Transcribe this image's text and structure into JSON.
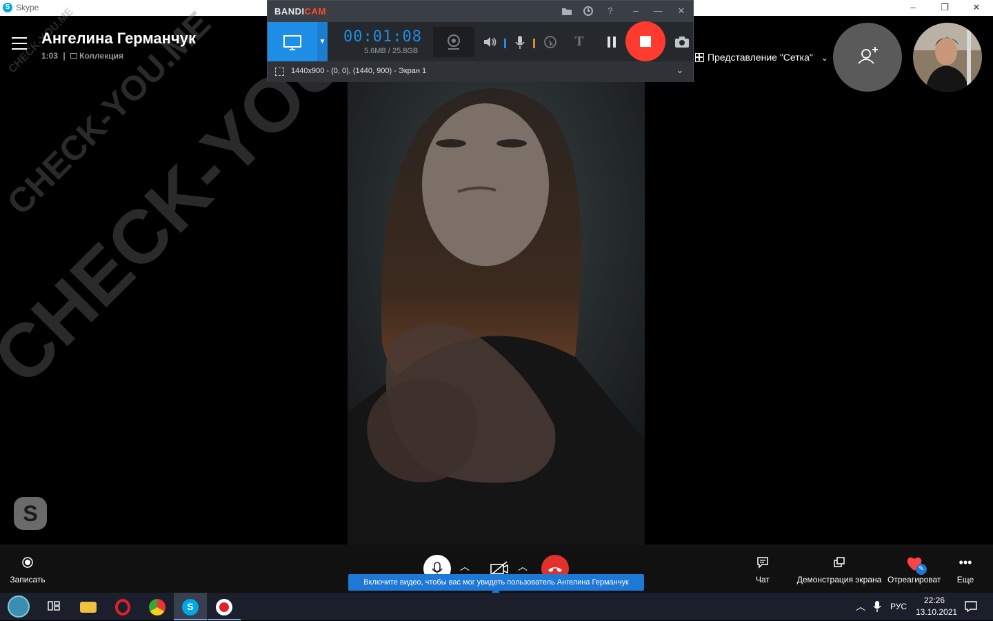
{
  "window": {
    "app_title": "Skype",
    "minimize": "–",
    "maximize": "❐",
    "close": "✕"
  },
  "call": {
    "contact_name": "Ангелина Германчук",
    "duration": "1:03",
    "separator": "|",
    "collection_label": "Коллекция",
    "grid_view_label": "Представление \"Сетка\"",
    "grid_view_chevron": "⌄"
  },
  "watermark": {
    "large": "CHECK-YOU.ME",
    "small": "CHECK-YOU.ME"
  },
  "bandicam": {
    "logo_part1": "BANDI",
    "logo_part2": "CAM",
    "timer": "00:01:08",
    "file_size": "5.6MB / 25.8GB",
    "region_label": "1440x900 - (0, 0), (1440, 900) - Экран 1",
    "accent_color": "#1f8ee6",
    "stop_color": "#ff3b2f"
  },
  "controls": {
    "record_label": "Записать",
    "chat_label": "Чат",
    "screen_share_label": "Демонстрация экрана",
    "react_label": "Отреагироват",
    "more_label": "Еще",
    "tooltip": "Включите видео, чтобы вас мог увидеть пользователь Ангелина Германчук",
    "end_call_color": "#e0322a"
  },
  "taskbar": {
    "language": "РУС",
    "time": "22:26",
    "date": "13.10.2021"
  }
}
